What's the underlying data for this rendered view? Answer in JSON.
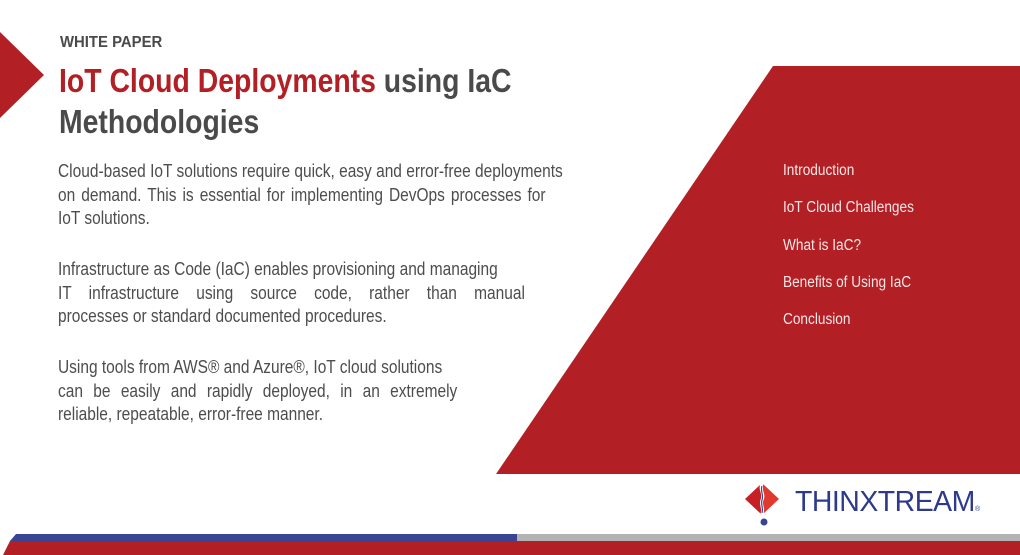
{
  "document": {
    "kicker": "WHITE PAPER",
    "title": {
      "accent": "IoT Cloud Deployments",
      "rest": " using IaC",
      "line2": "Methodologies"
    },
    "paragraphs": [
      {
        "lines": [
          "Cloud-based IoT solutions require quick, easy and error-free deployments",
          "on demand. This is essential for implementing DevOps processes for",
          "IoT solutions."
        ]
      },
      {
        "lines": [
          "Infrastructure as Code (IaC) enables provisioning and managing",
          "IT infrastructure using source code, rather than manual",
          "processes or standard documented procedures."
        ]
      },
      {
        "lines": [
          "Using tools from AWS® and Azure®, IoT cloud solutions",
          "can be easily and rapidly deployed, in an extremely",
          "reliable, repeatable, error-free manner."
        ]
      }
    ]
  },
  "toc": {
    "items": [
      {
        "label": "Introduction"
      },
      {
        "label": "IoT Cloud Challenges"
      },
      {
        "label": "What is IaC?"
      },
      {
        "label": "Benefits of Using IaC"
      },
      {
        "label": "Conclusion"
      }
    ]
  },
  "brand": {
    "name": "THINXTREAM",
    "registered_mark": "®",
    "logo_icon": "diamond-exclamation-icon"
  },
  "colors": {
    "brand_red": "#b22025",
    "brand_blue": "#2d3a8c",
    "text_gray": "#4a4a4a",
    "bar_gray": "#b3b3b3",
    "bar_blue": "#3a4490"
  }
}
